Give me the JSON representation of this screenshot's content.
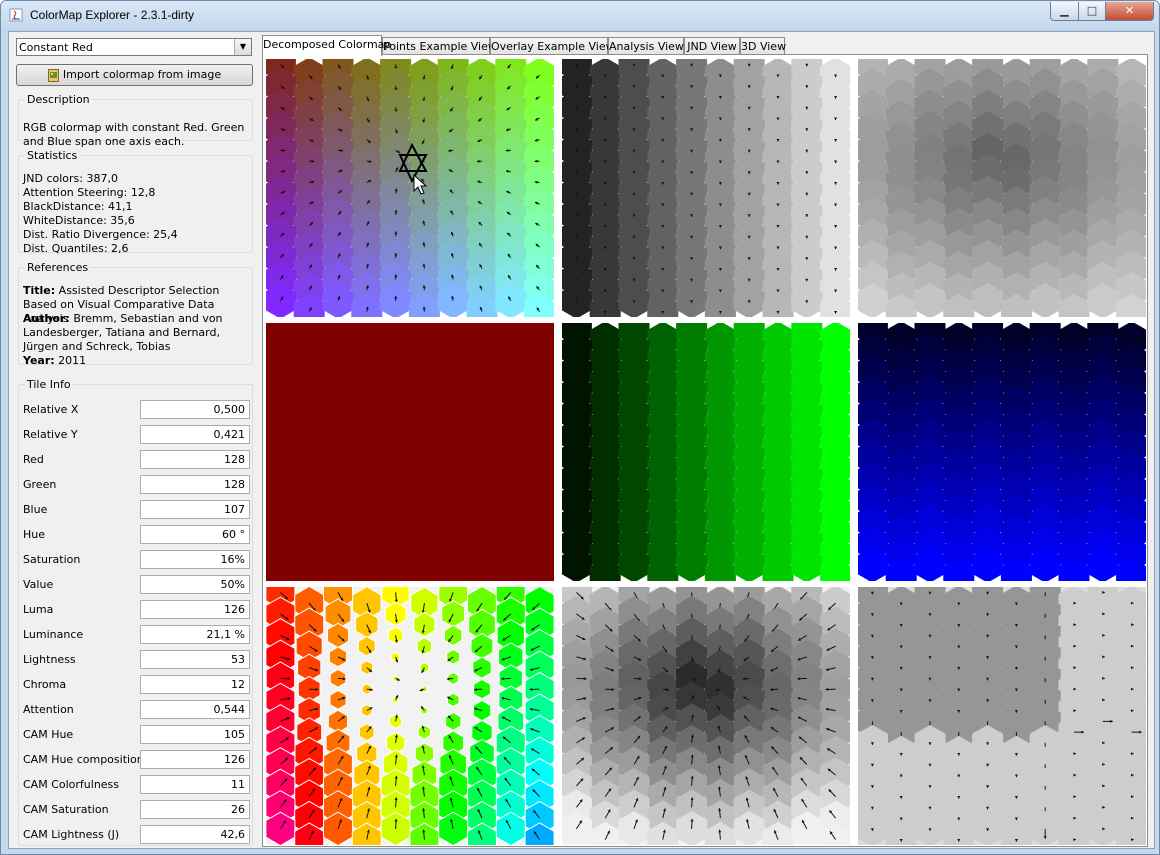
{
  "window": {
    "title": "ColorMap Explorer - 2.3.1-dirty",
    "controls": {
      "minimize": "▁",
      "maximize": "□",
      "close": "✕"
    }
  },
  "colormap_select": {
    "value": "Constant Red"
  },
  "import_button": {
    "label": "Import colormap from image",
    "icon": "image-icon"
  },
  "description": {
    "title": "Description",
    "text": "RGB colormap with constant Red. Green and Blue span one axis each."
  },
  "statistics": {
    "title": "Statistics",
    "items": [
      "JND colors: 387,0",
      "Attention Steering: 12,8",
      "BlackDistance: 41,1",
      "WhiteDistance: 35,6",
      "Dist. Ratio Divergence: 25,4",
      "Dist. Quantiles: 2,6"
    ]
  },
  "references": {
    "title": "References",
    "title_label": "Title:",
    "title_value": "Assisted Descriptor Selection Based on Visual Comparative Data Analysis",
    "author_label": "Author:",
    "author_value": "Bremm, Sebastian and von Landesberger, Tatiana and Bernard, Jürgen and Schreck, Tobias",
    "year_label": "Year:",
    "year_value": "2011"
  },
  "tile_info": {
    "title": "Tile Info",
    "rows": [
      {
        "label": "Relative X",
        "value": "0,500"
      },
      {
        "label": "Relative Y",
        "value": "0,421"
      },
      {
        "label": "Red",
        "value": "128"
      },
      {
        "label": "Green",
        "value": "128"
      },
      {
        "label": "Blue",
        "value": "107"
      },
      {
        "label": "Hue",
        "value": "60 °"
      },
      {
        "label": "Saturation",
        "value": "16%"
      },
      {
        "label": "Value",
        "value": "50%"
      },
      {
        "label": "Luma",
        "value": "126"
      },
      {
        "label": "Luminance",
        "value": "21,1 %"
      },
      {
        "label": "Lightness",
        "value": "53"
      },
      {
        "label": "Chroma",
        "value": "12"
      },
      {
        "label": "Attention",
        "value": "0,544"
      },
      {
        "label": "CAM Hue",
        "value": "105"
      },
      {
        "label": "CAM Hue composition",
        "value": "126"
      },
      {
        "label": "CAM Colorfulness",
        "value": "11"
      },
      {
        "label": "CAM Saturation",
        "value": "26"
      },
      {
        "label": "CAM Lightness (J)",
        "value": "42,6"
      }
    ]
  },
  "tabs": [
    {
      "label": "Decomposed Colormap",
      "active": true
    },
    {
      "label": "Points Example View",
      "active": false
    },
    {
      "label": "Overlay Example View",
      "active": false
    },
    {
      "label": "Analysis View",
      "active": false
    },
    {
      "label": "JND View",
      "active": false
    },
    {
      "label": "3D View",
      "active": false
    }
  ],
  "tiles": [
    {
      "name": "tile-colormap-rgb",
      "kind": "rgb"
    },
    {
      "name": "tile-lightness-gray",
      "kind": "gray-columns"
    },
    {
      "name": "tile-luminance-gray",
      "kind": "gray-radial"
    },
    {
      "name": "tile-red-channel",
      "kind": "red"
    },
    {
      "name": "tile-green-channel",
      "kind": "green"
    },
    {
      "name": "tile-blue-channel",
      "kind": "blue"
    },
    {
      "name": "tile-hue-hexagons",
      "kind": "hue"
    },
    {
      "name": "tile-saturation-hexagons",
      "kind": "sat"
    },
    {
      "name": "tile-attention-hexagons",
      "kind": "att"
    }
  ],
  "colors": {
    "titlebar": "#c1d6ee",
    "window_bg": "#f0f0f0",
    "close_button": "#c34c35",
    "red_channel": "#800000"
  }
}
